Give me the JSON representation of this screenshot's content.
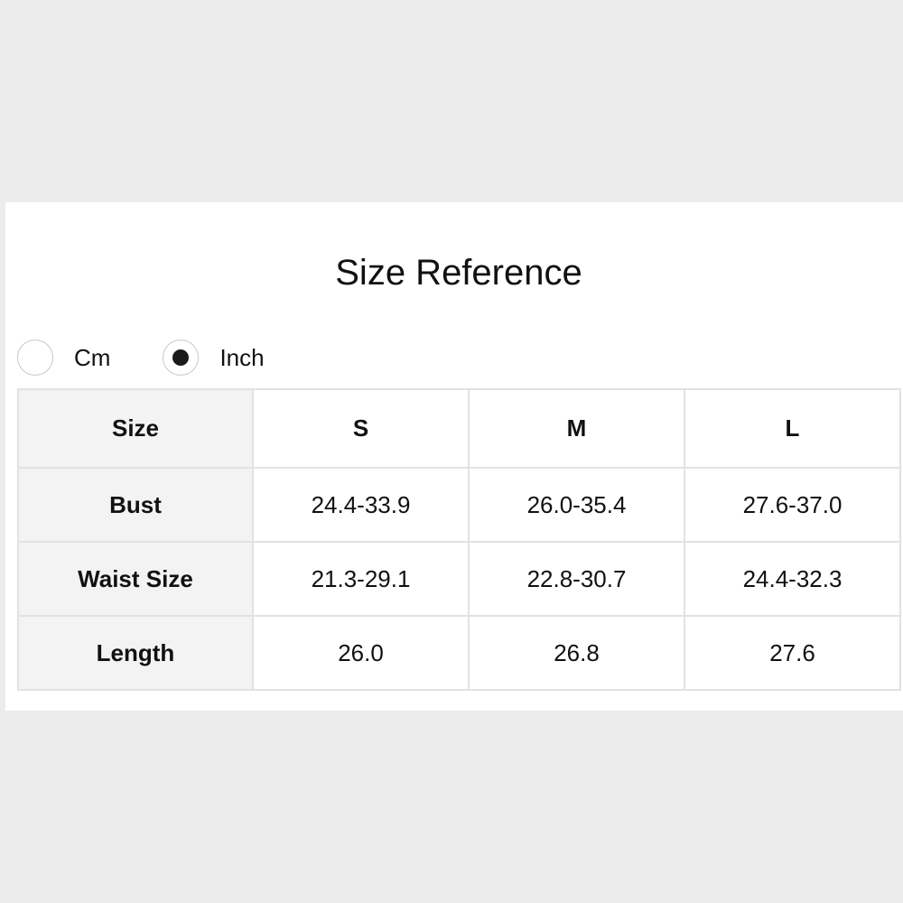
{
  "title": "Size Reference",
  "units": {
    "options": [
      {
        "label": "Cm",
        "selected": false
      },
      {
        "label": "Inch",
        "selected": true
      }
    ]
  },
  "table": {
    "corner_header": "Size",
    "columns": [
      "S",
      "M",
      "L"
    ],
    "rows": [
      {
        "label": "Bust",
        "values": [
          "24.4-33.9",
          "26.0-35.4",
          "27.6-37.0"
        ]
      },
      {
        "label": "Waist Size",
        "values": [
          "21.3-29.1",
          "22.8-30.7",
          "24.4-32.3"
        ]
      },
      {
        "label": "Length",
        "values": [
          "26.0",
          "26.8",
          "27.6"
        ]
      }
    ]
  },
  "colors": {
    "page_background": "#ececec",
    "panel_background": "#ffffff",
    "label_cell_background": "#f3f3f3",
    "border": "#e2e2e2"
  }
}
